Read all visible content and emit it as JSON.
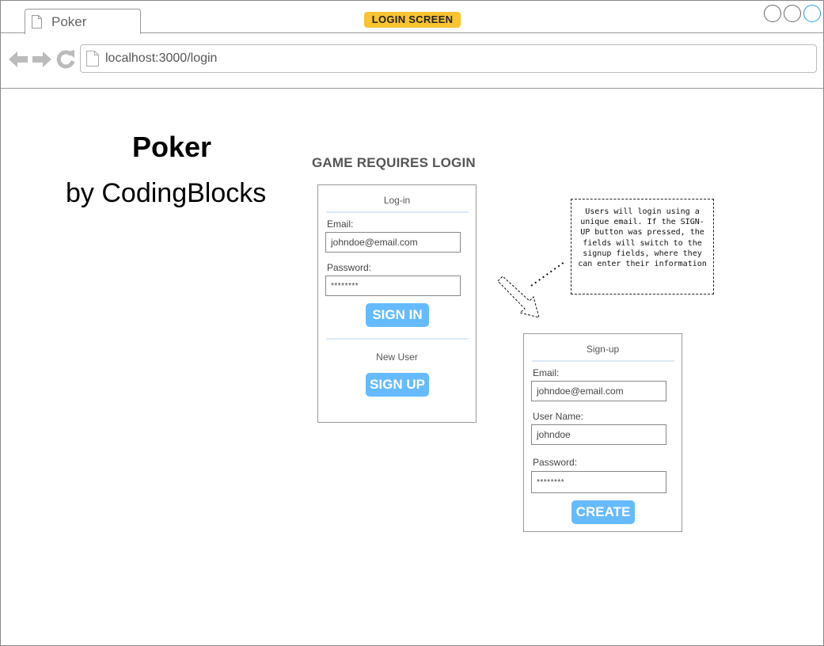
{
  "browser": {
    "tab_title": "Poker",
    "screen_badge": "LOGIN SCREEN",
    "url": "localhost:3000/login"
  },
  "page": {
    "title": "Poker",
    "subtitle": "by CodingBlocks",
    "requirement_text": "GAME REQUIRES LOGIN"
  },
  "login_panel": {
    "title": "Log-in",
    "email_label": "Email:",
    "email_value": "johndoe@email.com",
    "password_label": "Password:",
    "password_value": "********",
    "signin_button": "SIGN IN",
    "new_user_text": "New User",
    "signup_button": "SIGN UP"
  },
  "signup_panel": {
    "title": "Sign-up",
    "email_label": "Email:",
    "email_value": "johndoe@email.com",
    "username_label": "User Name:",
    "username_value": "johndoe",
    "password_label": "Password:",
    "password_value": "********",
    "create_button": "CREATE"
  },
  "annotation": {
    "text": "Users will login using a unique email. If the SIGN-UP button was pressed, the fields will switch to the signup fields, where they can enter their information"
  },
  "colors": {
    "badge": "#f9c331",
    "button": "#66bbff",
    "separator": "#dde9f9"
  },
  "icons": [
    "page-icon",
    "back-arrow-icon",
    "forward-arrow-icon",
    "reload-icon",
    "window-circle-icon",
    "dashed-arrow-icon"
  ]
}
